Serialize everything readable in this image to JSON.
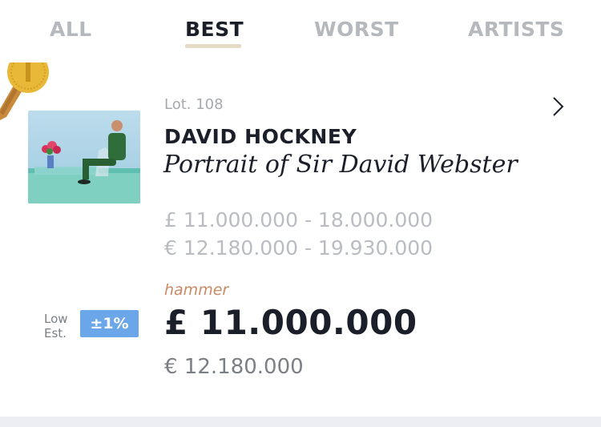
{
  "tabs": [
    {
      "label": "ALL",
      "active": false
    },
    {
      "label": "BEST",
      "active": true
    },
    {
      "label": "WORST",
      "active": false
    },
    {
      "label": "ARTISTS",
      "active": false
    }
  ],
  "lot": {
    "lot_label": "Lot. 108",
    "artist": "DAVID HOCKNEY",
    "title": "Portrait of Sir David Webster",
    "estimate_gbp": "£ 11.000.000 - 18.000.000",
    "estimate_eur": "€ 12.180.000 - 19.930.000",
    "hammer_label": "hammer",
    "hammer_gbp": "£ 11.000.000",
    "hammer_eur": "€ 12.180.000",
    "low_est_label": "Low Est.",
    "pct_badge": "±1%"
  },
  "icons": {
    "medal": "gold-medal-icon",
    "chevron": "chevron-right-icon"
  },
  "colors": {
    "text_primary": "#1b1f2a",
    "text_muted": "#b5b8bd",
    "hammer_accent": "#c98a63",
    "badge_blue": "#6aa6e8",
    "tab_underline": "#e6dcc6",
    "medal_gold": "#e8b938"
  }
}
